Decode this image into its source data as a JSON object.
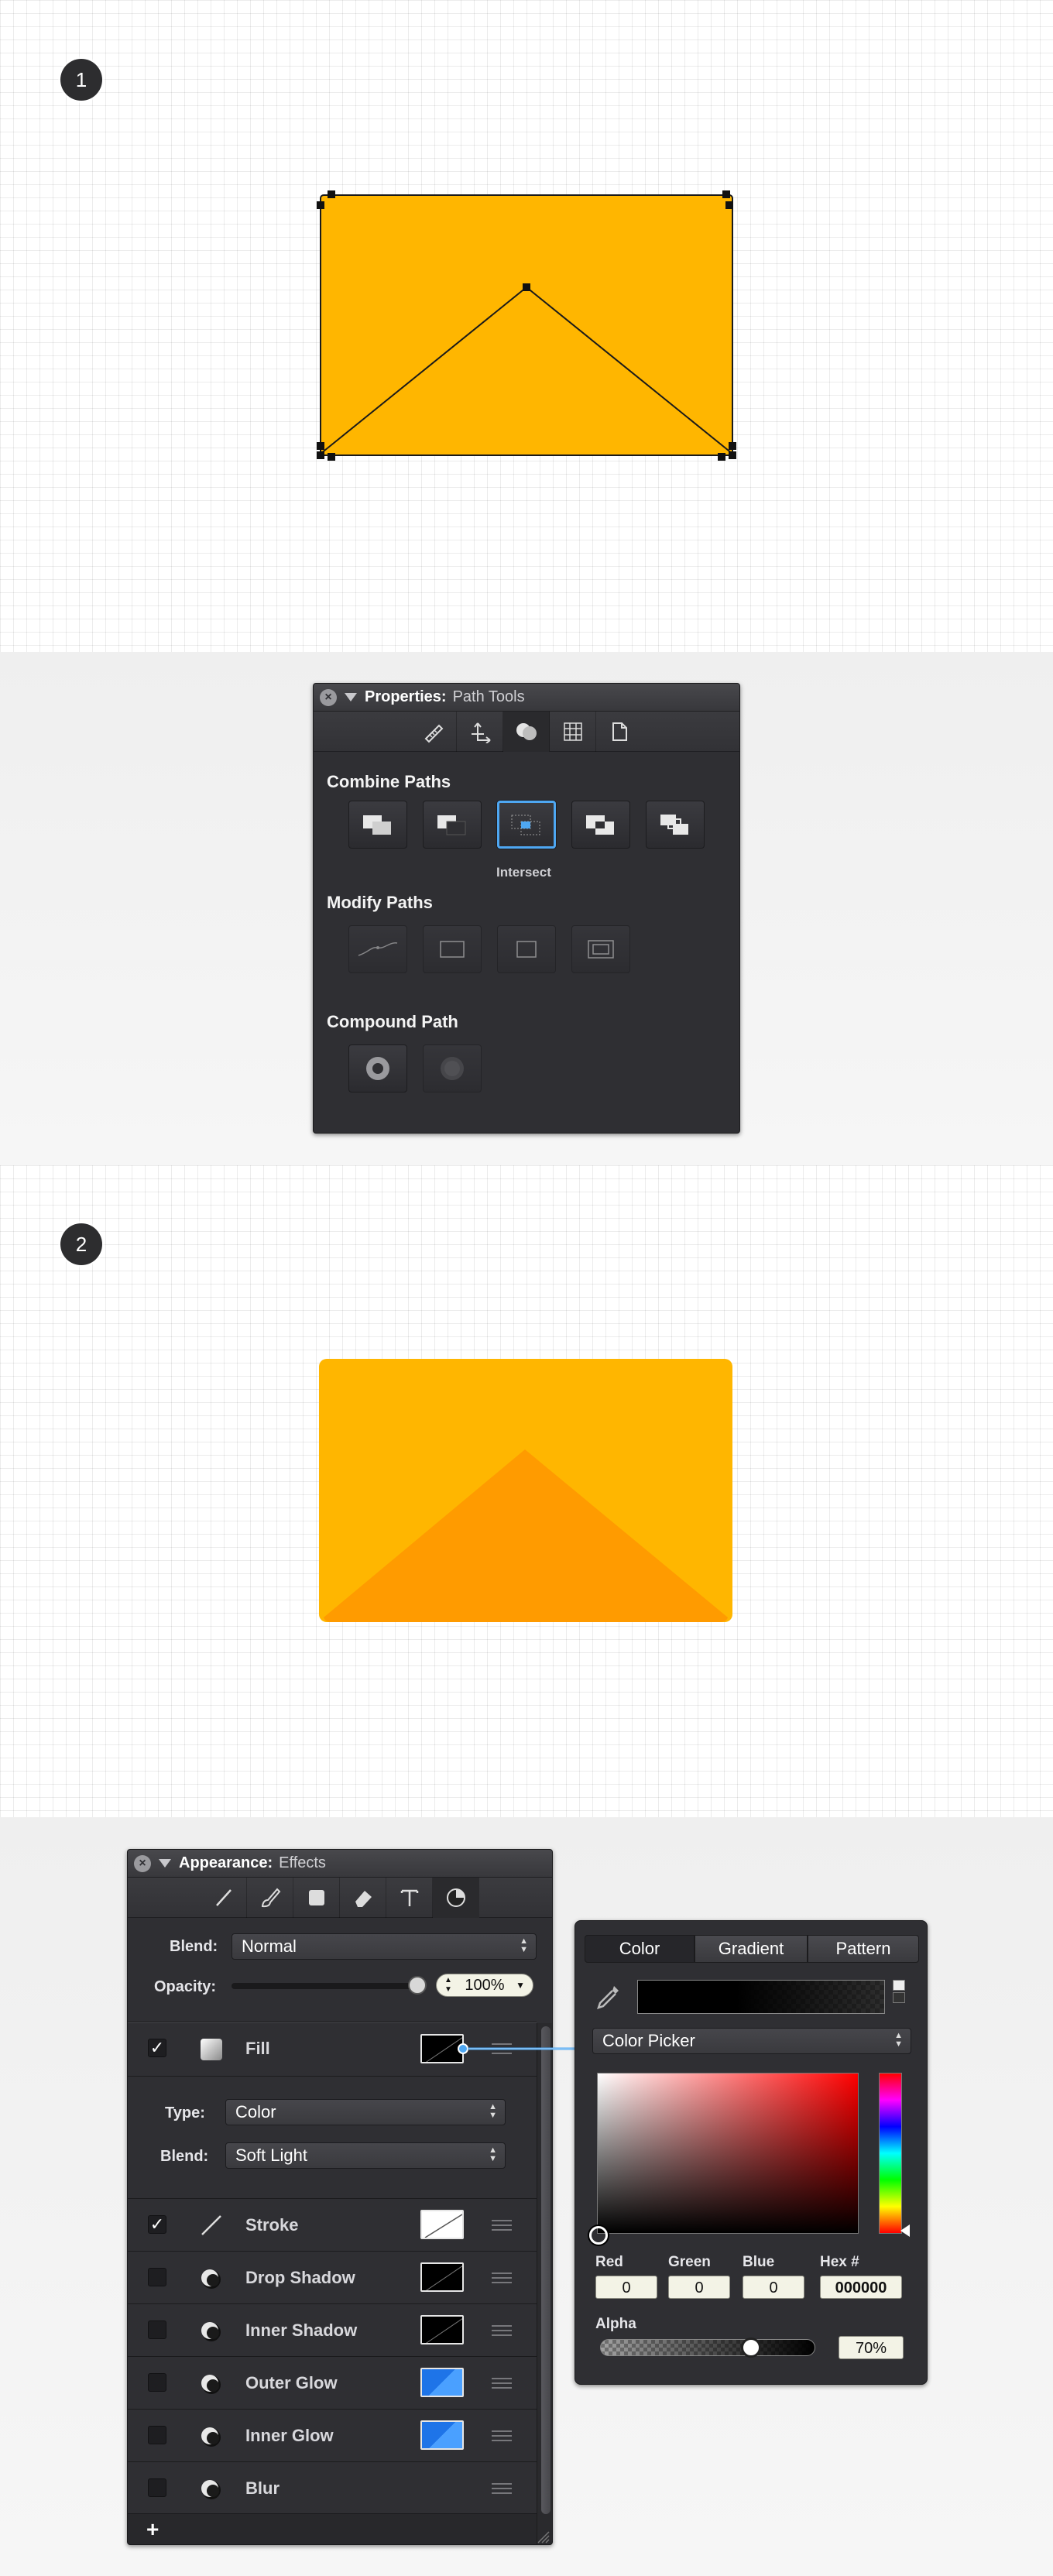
{
  "steps": {
    "step1": "1",
    "step2": "2"
  },
  "colors": {
    "shape_fill": "#FFB600",
    "triangle_fill": "#FF9B00",
    "accent": "#4EA7F2"
  },
  "properties_panel": {
    "title": "Properties:",
    "subtitle": "Path Tools",
    "close_icon": "close-icon",
    "tabs": [
      "ruler-icon",
      "transform-icon",
      "path-tools-icon",
      "grid-icon",
      "document-icon"
    ],
    "sections": {
      "combine": {
        "title": "Combine Paths",
        "tools": [
          "union-icon",
          "subtract-icon",
          "intersect-icon",
          "exclude-icon",
          "divide-icon"
        ],
        "selected_label": "Intersect"
      },
      "modify": {
        "title": "Modify Paths",
        "tools": [
          "curve-path-icon",
          "rectangle-path-icon",
          "square-path-icon",
          "inset-rect-icon"
        ]
      },
      "compound": {
        "title": "Compound Path",
        "tools": [
          "make-compound-icon",
          "release-compound-icon"
        ]
      }
    }
  },
  "appearance_panel": {
    "title": "Appearance:",
    "subtitle": "Effects",
    "tabs": [
      "line-icon",
      "brush-icon",
      "fill-icon",
      "eraser-icon",
      "text-icon",
      "effects-icon"
    ],
    "blend_label": "Blend:",
    "blend_value": "Normal",
    "opacity_label": "Opacity:",
    "opacity_value": "100%",
    "opacity_level": 1.0,
    "fill": {
      "checked": true,
      "name": "Fill",
      "type_label": "Type:",
      "type_value": "Color",
      "blend_label": "Blend:",
      "blend_value": "Soft Light"
    },
    "effects": [
      {
        "name": "Stroke",
        "checked": true,
        "icon": "line-icon",
        "swatch": "stroke-none"
      },
      {
        "name": "Drop Shadow",
        "checked": false,
        "icon": "effect-sphere-icon",
        "swatch": "black"
      },
      {
        "name": "Inner Shadow",
        "checked": false,
        "icon": "effect-sphere-icon",
        "swatch": "black"
      },
      {
        "name": "Outer Glow",
        "checked": false,
        "icon": "effect-sphere-icon",
        "swatch": "blue"
      },
      {
        "name": "Inner Glow",
        "checked": false,
        "icon": "effect-sphere-icon",
        "swatch": "blue"
      },
      {
        "name": "Blur",
        "checked": false,
        "icon": "effect-sphere-icon",
        "swatch": "none"
      }
    ],
    "add_label": "+"
  },
  "color_picker": {
    "tabs": [
      "Color",
      "Gradient",
      "Pattern"
    ],
    "active_tab": "Color",
    "mode": "Color Picker",
    "red_label": "Red",
    "green_label": "Green",
    "blue_label": "Blue",
    "hex_label": "Hex #",
    "red": "0",
    "green": "0",
    "blue": "0",
    "hex": "000000",
    "alpha_label": "Alpha",
    "alpha_value": "70%",
    "alpha_level": 0.7
  }
}
